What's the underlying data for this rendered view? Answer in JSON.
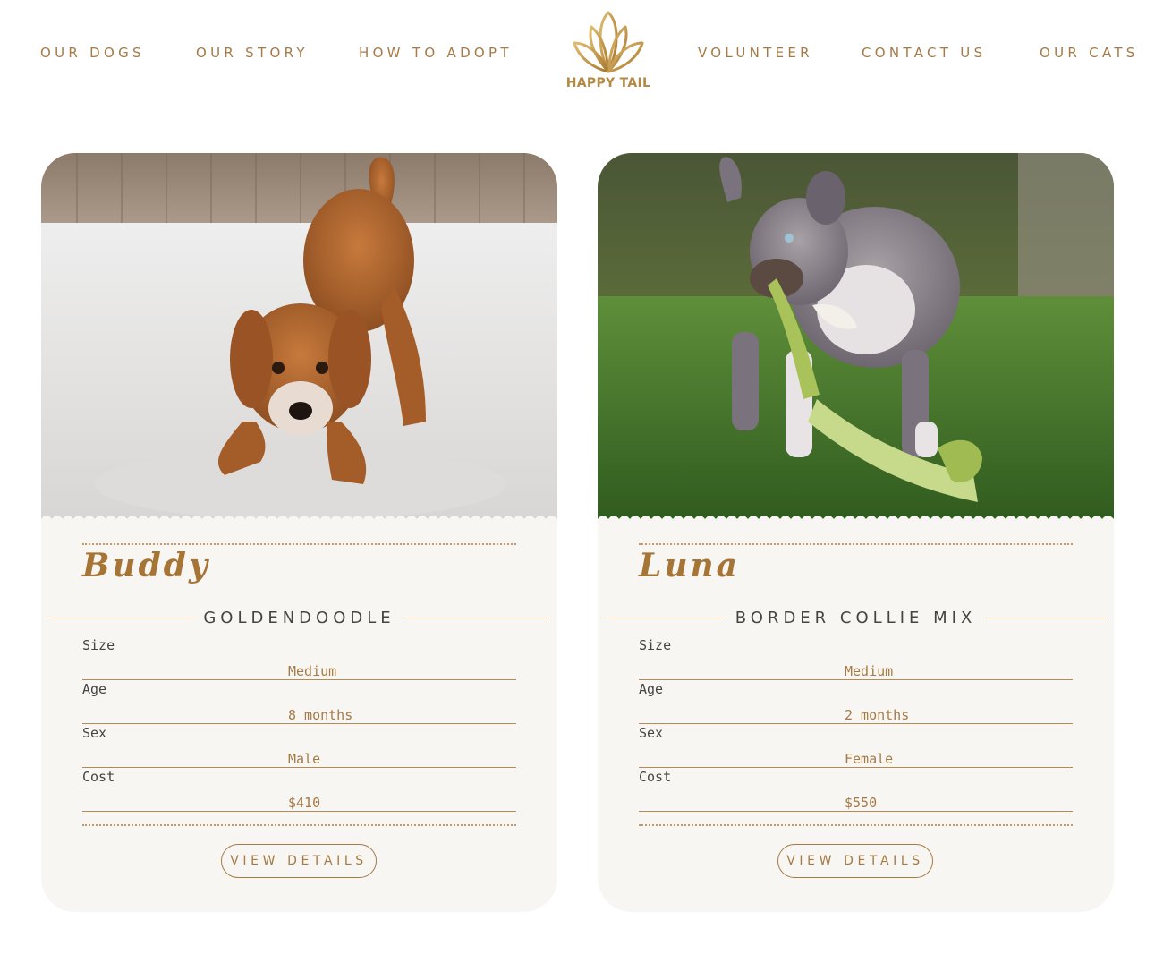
{
  "nav": {
    "left": [
      "OUR DOGS",
      "OUR STORY",
      "HOW TO ADOPT"
    ],
    "right": [
      "VOLUNTEER",
      "CONTACT US",
      "OUR CATS"
    ],
    "logo_text": "HAPPY TAIL"
  },
  "colors": {
    "accent": "#a67a45",
    "card_background": "#f8f6f3",
    "name": "#a67434",
    "text": "#444444"
  },
  "dogs": [
    {
      "name": "Buddy",
      "breed": "GOLDENDOODLE",
      "photo": "goldendoodle-playing-in-snow",
      "specs": [
        {
          "label": "Size",
          "value": "Medium"
        },
        {
          "label": "Age",
          "value": "8 months"
        },
        {
          "label": "Sex",
          "value": "Male"
        },
        {
          "label": "Cost",
          "value": "$410"
        }
      ],
      "button": "VIEW DETAILS"
    },
    {
      "name": "Luna",
      "breed": "BORDER COLLIE MIX",
      "photo": "border-collie-puppy-with-toy-on-grass",
      "specs": [
        {
          "label": "Size",
          "value": "Medium"
        },
        {
          "label": "Age",
          "value": "2 months"
        },
        {
          "label": "Sex",
          "value": "Female"
        },
        {
          "label": "Cost",
          "value": "$550"
        }
      ],
      "button": "VIEW DETAILS"
    }
  ]
}
